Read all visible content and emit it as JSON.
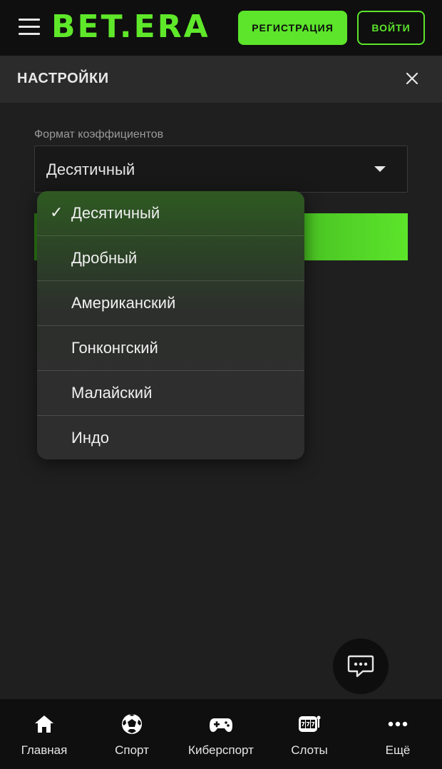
{
  "header": {
    "logo_text": "BET.ERA",
    "register_label": "РЕГИСТРАЦИЯ",
    "login_label": "ВОЙТИ",
    "accent_color": "#5ce52b"
  },
  "settings": {
    "title": "НАСТРОЙКИ",
    "field_label": "Формат коэффициентов",
    "selected_value": "Десятичный"
  },
  "dropdown": {
    "check_mark": "✓",
    "options": [
      {
        "label": "Десятичный",
        "selected": true
      },
      {
        "label": "Дробный",
        "selected": false
      },
      {
        "label": "Американский",
        "selected": false
      },
      {
        "label": "Гонконгский",
        "selected": false
      },
      {
        "label": "Малайский",
        "selected": false
      },
      {
        "label": "Индо",
        "selected": false
      }
    ]
  },
  "bottom_nav": {
    "items": [
      {
        "label": "Главная",
        "icon": "home-icon"
      },
      {
        "label": "Спорт",
        "icon": "soccer-ball-icon"
      },
      {
        "label": "Киберспорт",
        "icon": "gamepad-icon"
      },
      {
        "label": "Слоты",
        "icon": "slot-machine-icon"
      },
      {
        "label": "Ещё",
        "icon": "more-dots-icon"
      }
    ]
  }
}
